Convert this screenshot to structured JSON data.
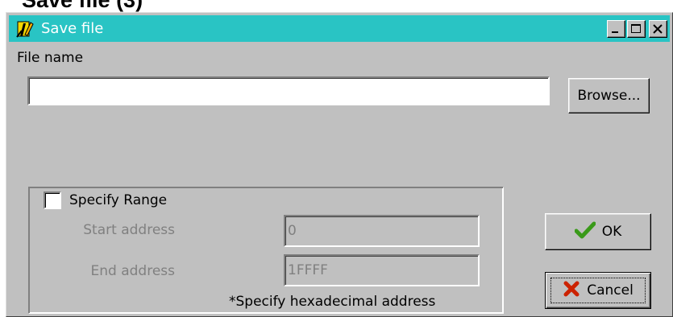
{
  "page_heading": "Save file (3)",
  "window": {
    "title": "Save file",
    "title_bar_color": "#29c4c4",
    "icons": {
      "app": "save-file-app-icon",
      "minimize": "minimize-icon",
      "maximize": "maximize-icon",
      "close": "close-icon"
    }
  },
  "file": {
    "label": "File name",
    "value": "",
    "browse_label": "Browse..."
  },
  "range": {
    "checkbox_label": "Specify Range",
    "checked": false,
    "start_label": "Start address",
    "start_value": "0",
    "end_label": "End address",
    "end_value": "1FFFF",
    "note": "*Specify hexadecimal address"
  },
  "buttons": {
    "ok_label": "OK",
    "ok_icon": "checkmark-icon",
    "ok_icon_color": "#3a9a1a",
    "cancel_label": "Cancel",
    "cancel_icon": "x-icon",
    "cancel_icon_color": "#cc2200"
  }
}
